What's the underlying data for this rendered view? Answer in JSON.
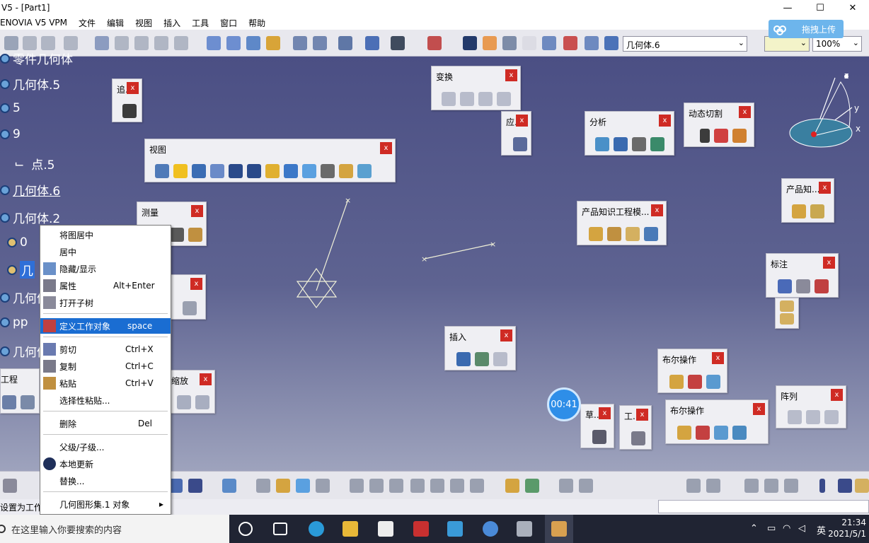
{
  "window": {
    "title": "V5 - [Part1]",
    "controls": {
      "minimize": "—",
      "maximize": "☐",
      "close": "✕"
    }
  },
  "menu": [
    "ENOVIA V5 VPM",
    "文件",
    "编辑",
    "视图",
    "插入",
    "工具",
    "窗口",
    "帮助"
  ],
  "toolbar": {
    "layer_combo": "几何体.6",
    "zoom_combo": "100%"
  },
  "upload_button": "拖拽上传",
  "tree": [
    {
      "label": "零件几何体",
      "y": 82
    },
    {
      "label": "几何体.5"
    },
    {
      "label": "5"
    },
    {
      "label": "9"
    },
    {
      "label": "点.5"
    },
    {
      "label": "几何体.6"
    },
    {
      "label": "几何体.2"
    },
    {
      "label": "0"
    },
    {
      "label": "几"
    },
    {
      "label": "几何体"
    },
    {
      "label": "pp"
    },
    {
      "label": "几何体"
    }
  ],
  "panels": {
    "zhui": "追...",
    "view": "视图",
    "measure": "测量",
    "transform": "变换",
    "apply": "应...",
    "analysis": "分析",
    "dynamic_cut": "动态切割",
    "product_know": "产品知...",
    "product_know_eng": "产品知识工程模...",
    "annotation": "标注",
    "insert": "插入",
    "boolean1": "布尔操作",
    "boolean2": "布尔操作",
    "pattern": "阵列",
    "sketch": "草...",
    "work": "工...",
    "zoom": "缩放",
    "engineering": "工程"
  },
  "context_menu": [
    {
      "label": "将图居中",
      "shortcut": ""
    },
    {
      "label": "居中",
      "shortcut": ""
    },
    {
      "label": "隐藏/显示",
      "shortcut": ""
    },
    {
      "label": "属性",
      "shortcut": "Alt+Enter"
    },
    {
      "label": "打开子树",
      "shortcut": ""
    },
    {
      "label": "定义工作对象",
      "shortcut": "space"
    },
    {
      "label": "剪切",
      "shortcut": "Ctrl+X"
    },
    {
      "label": "复制",
      "shortcut": "Ctrl+C"
    },
    {
      "label": "粘贴",
      "shortcut": "Ctrl+V"
    },
    {
      "label": "选择性粘贴...",
      "shortcut": ""
    },
    {
      "label": "删除",
      "shortcut": "Del"
    },
    {
      "label": "父级/子级...",
      "shortcut": ""
    },
    {
      "label": "本地更新",
      "shortcut": ""
    },
    {
      "label": "替换...",
      "shortcut": ""
    },
    {
      "label": "几何图形集.1 对象",
      "shortcut": "▸"
    }
  ],
  "status": {
    "message": "设置为工作",
    "timer": "00:41"
  },
  "taskbar": {
    "search_placeholder": "在这里输入你要搜索的内容",
    "time": "21:34",
    "date": "2021/5/1",
    "lang": "英"
  },
  "colors": {
    "workspace": "#5a5f8c",
    "highlight": "#1a6dd2",
    "close": "#cf2b24"
  }
}
